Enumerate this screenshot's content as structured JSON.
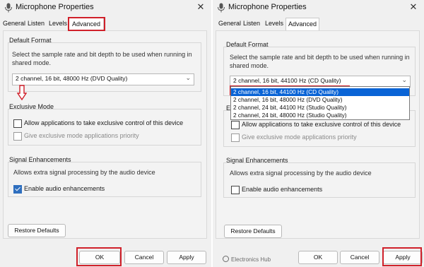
{
  "title": "Microphone Properties",
  "tabs": [
    "General",
    "Listen",
    "Levels",
    "Advanced"
  ],
  "default_format": {
    "label": "Default Format",
    "description": "Select the sample rate and bit depth to be used when running in shared mode.",
    "left_value": "2 channel, 16 bit, 48000 Hz (DVD Quality)",
    "right_value": "2 channel, 16 bit, 44100 Hz (CD Quality)",
    "options": [
      "2 channel, 16 bit, 44100 Hz (CD Quality)",
      "2 channel, 16 bit, 48000 Hz (DVD Quality)",
      "2 channel, 24 bit, 44100 Hz (Studio Quality)",
      "2 channel, 24 bit, 48000 Hz (Studio Quality)"
    ],
    "selected_option_index": 0
  },
  "exclusive_mode": {
    "label": "Exclusive Mode",
    "allow_exclusive": "Allow applications to take exclusive control of this device",
    "give_priority": "Give exclusive mode applications priority"
  },
  "signal": {
    "label": "Signal Enhancements",
    "description": "Allows extra signal processing by the audio device",
    "enable": "Enable audio enhancements",
    "left_checked": true,
    "right_checked": false
  },
  "buttons": {
    "restore": "Restore Defaults",
    "ok": "OK",
    "cancel": "Cancel",
    "apply": "Apply"
  },
  "watermark": "Electronics Hub",
  "colors": {
    "highlight": "#d0202a",
    "selection": "#0a64d6",
    "checkbox": "#2f6fbf"
  }
}
